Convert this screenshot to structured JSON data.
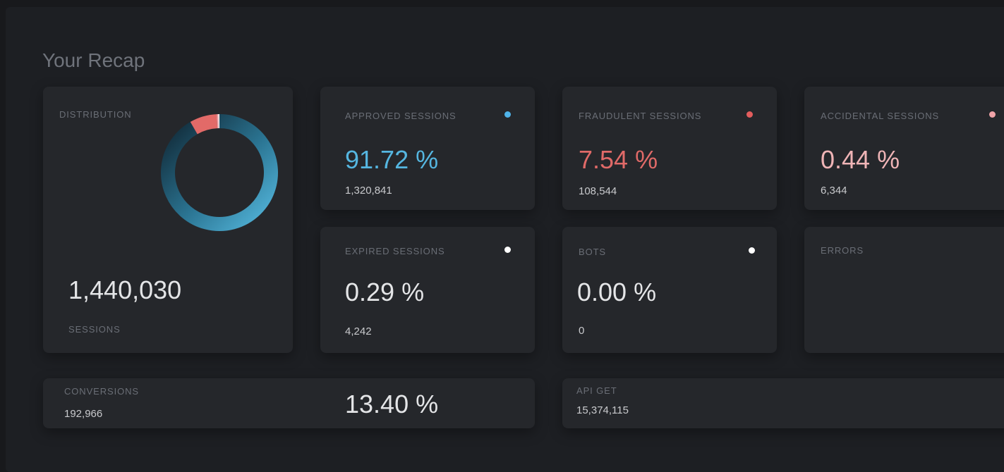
{
  "title": "Your Recap",
  "distribution": {
    "label": "DISTRIBUTION",
    "total": "1,440,030",
    "total_label": "SESSIONS",
    "slices": [
      {
        "name": "approved",
        "value": 91.72,
        "color": "#4fb3dc"
      },
      {
        "name": "fraudulent",
        "value": 7.54,
        "color": "#e26a68"
      },
      {
        "name": "accidental",
        "value": 0.44,
        "color": "#f0a3a8"
      },
      {
        "name": "expired",
        "value": 0.29,
        "color": "#ffffff"
      }
    ]
  },
  "cards": {
    "approved": {
      "label": "APPROVED SESSIONS",
      "pct": "91.72 %",
      "count": "1,320,841",
      "dot_color": "#4fb3e9",
      "pct_color": "#55b6e0"
    },
    "fraudulent": {
      "label": "FRAUDULENT SESSIONS",
      "pct": "7.54 %",
      "count": "108,544",
      "dot_color": "#e35d5d",
      "pct_color": "#e06a68"
    },
    "accidental": {
      "label": "ACCIDENTAL SESSIONS",
      "pct": "0.44 %",
      "count": "6,344",
      "dot_color": "#f0a3a8",
      "pct_color": "#efb4b6"
    },
    "expired": {
      "label": "EXPIRED SESSIONS",
      "pct": "0.29 %",
      "count": "4,242",
      "dot_color": "#ffffff",
      "pct_color": "#e4e5e7"
    },
    "bots": {
      "label": "BOTS",
      "pct": "0.00 %",
      "count": "0",
      "dot_color": "#ffffff",
      "pct_color": "#e4e5e7"
    },
    "errors": {
      "label": "ERRORS"
    }
  },
  "conversions": {
    "label": "CONVERSIONS",
    "count": "192,966",
    "pct": "13.40 %"
  },
  "api_get": {
    "label": "API GET",
    "count": "15,374,115"
  }
}
